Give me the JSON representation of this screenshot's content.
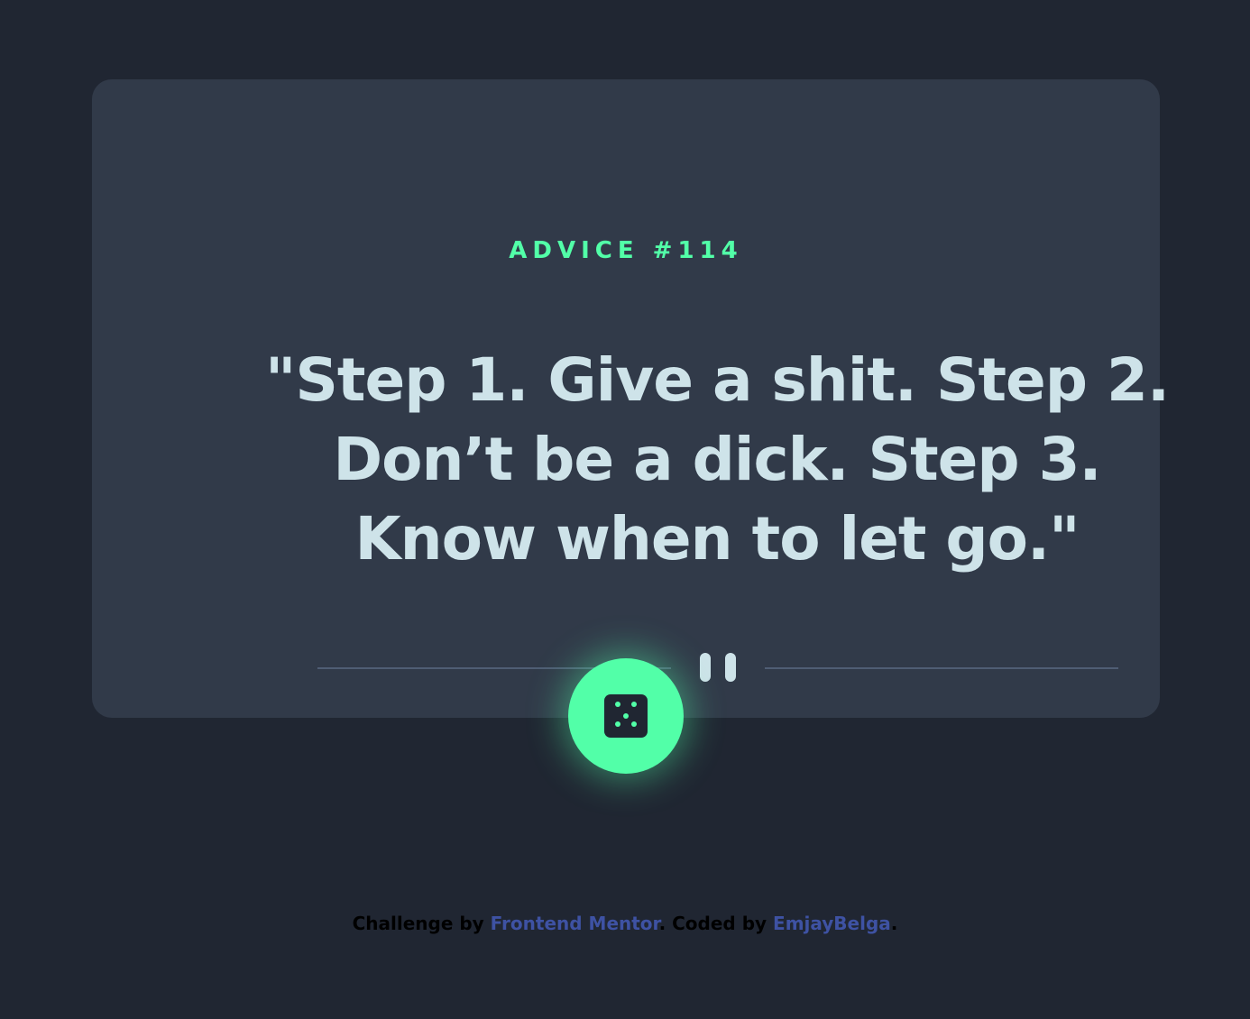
{
  "advice": {
    "id_label": "ADVICE #114",
    "quote": "\"Step 1. Give a shit. Step 2. Don’t be a dick. Step 3. Know when to let go.\""
  },
  "divider": {
    "icon": "pause-icon"
  },
  "dice_button": {
    "icon": "dice-icon"
  },
  "attribution": {
    "prefix": "Challenge by ",
    "challenge_link": "Frontend Mentor",
    "middle": ". Coded by ",
    "author_link": "EmjayBelga",
    "suffix": "."
  },
  "colors": {
    "background": "#202632",
    "card": "#313a49",
    "accent": "#52ffa8",
    "quote_text": "#cee3e9",
    "divider": "#4f5d74",
    "link": "#3e52a3"
  }
}
